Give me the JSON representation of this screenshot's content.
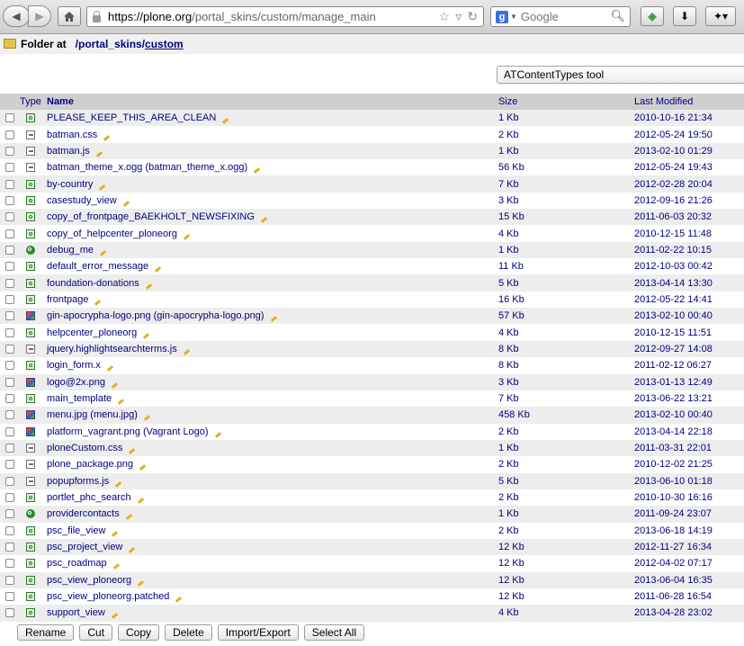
{
  "browser": {
    "url_host": "https://plone.org",
    "url_path": "/portal_skins/custom/manage_main",
    "search_placeholder": "Google"
  },
  "folder": {
    "label": "Folder at",
    "path_prefix": "/portal_skins/",
    "path_link": "custom"
  },
  "add_select": {
    "selected": "ATContentTypes tool"
  },
  "table": {
    "headers": {
      "type": "Type",
      "name": "Name",
      "size": "Size",
      "modified": "Last Modified"
    },
    "rows": [
      {
        "icon": "template-icon",
        "name": "PLEASE_KEEP_THIS_AREA_CLEAN",
        "size": "1 Kb",
        "date": "2010-10-16 21:34"
      },
      {
        "icon": "file-icon",
        "name": "batman.css",
        "size": "2 Kb",
        "date": "2012-05-24 19:50"
      },
      {
        "icon": "file-icon",
        "name": "batman.js",
        "size": "1 Kb",
        "date": "2013-02-10 01:29"
      },
      {
        "icon": "file-icon",
        "name": "batman_theme_x.ogg (batman_theme_x.ogg)",
        "size": "56 Kb",
        "date": "2012-05-24 19:43"
      },
      {
        "icon": "template-icon",
        "name": "by-country",
        "size": "7 Kb",
        "date": "2012-02-28 20:04"
      },
      {
        "icon": "template-icon",
        "name": "casestudy_view",
        "size": "3 Kb",
        "date": "2012-09-16 21:26"
      },
      {
        "icon": "template-icon",
        "name": "copy_of_frontpage_BAEKHOLT_NEWSFIXING",
        "size": "15 Kb",
        "date": "2011-06-03 20:32"
      },
      {
        "icon": "template-icon",
        "name": "copy_of_helpcenter_ploneorg",
        "size": "4 Kb",
        "date": "2010-12-15 11:48"
      },
      {
        "icon": "python-script-icon",
        "name": "debug_me",
        "size": "1 Kb",
        "date": "2011-02-22 10:15"
      },
      {
        "icon": "template-icon",
        "name": "default_error_message",
        "size": "11 Kb",
        "date": "2012-10-03 00:42"
      },
      {
        "icon": "template-icon",
        "name": "foundation-donations",
        "size": "5 Kb",
        "date": "2013-04-14 13:30"
      },
      {
        "icon": "template-icon",
        "name": "frontpage",
        "size": "16 Kb",
        "date": "2012-05-22 14:41"
      },
      {
        "icon": "image-icon",
        "name": "gin-apocrypha-logo.png (gin-apocrypha-logo.png)",
        "size": "57 Kb",
        "date": "2013-02-10 00:40"
      },
      {
        "icon": "template-icon",
        "name": "helpcenter_ploneorg",
        "size": "4 Kb",
        "date": "2010-12-15 11:51"
      },
      {
        "icon": "file-icon",
        "name": "jquery.highlightsearchterms.js",
        "size": "8 Kb",
        "date": "2012-09-27 14:08"
      },
      {
        "icon": "template-icon",
        "name": "login_form.x",
        "size": "8 Kb",
        "date": "2011-02-12 06:27"
      },
      {
        "icon": "image-icon",
        "name": "logo@2x.png",
        "size": "3 Kb",
        "date": "2013-01-13 12:49"
      },
      {
        "icon": "template-icon",
        "name": "main_template",
        "size": "7 Kb",
        "date": "2013-06-22 13:21"
      },
      {
        "icon": "image-icon",
        "name": "menu.jpg (menu.jpg)",
        "size": "458 Kb",
        "date": "2013-02-10 00:40"
      },
      {
        "icon": "image-icon",
        "name": "platform_vagrant.png (Vagrant Logo)",
        "size": "2 Kb",
        "date": "2013-04-14 22:18"
      },
      {
        "icon": "file-icon",
        "name": "ploneCustom.css",
        "size": "1 Kb",
        "date": "2011-03-31 22:01"
      },
      {
        "icon": "file-icon",
        "name": "plone_package.png",
        "size": "2 Kb",
        "date": "2010-12-02 21:25"
      },
      {
        "icon": "file-icon",
        "name": "popupforms.js",
        "size": "5 Kb",
        "date": "2013-06-10 01:18"
      },
      {
        "icon": "template-icon",
        "name": "portlet_phc_search",
        "size": "2 Kb",
        "date": "2010-10-30 16:16"
      },
      {
        "icon": "python-script-icon",
        "name": "providercontacts",
        "size": "1 Kb",
        "date": "2011-09-24 23:07"
      },
      {
        "icon": "template-icon",
        "name": "psc_file_view",
        "size": "2 Kb",
        "date": "2013-06-18 14:19"
      },
      {
        "icon": "template-icon",
        "name": "psc_project_view",
        "size": "12 Kb",
        "date": "2012-11-27 16:34"
      },
      {
        "icon": "template-icon",
        "name": "psc_roadmap",
        "size": "12 Kb",
        "date": "2012-04-02 07:17"
      },
      {
        "icon": "template-icon",
        "name": "psc_view_ploneorg",
        "size": "12 Kb",
        "date": "2013-06-04 16:35"
      },
      {
        "icon": "template-icon",
        "name": "psc_view_ploneorg.patched",
        "size": "12 Kb",
        "date": "2011-06-28 16:54"
      },
      {
        "icon": "template-icon",
        "name": "support_view",
        "size": "4 Kb",
        "date": "2013-04-28 23:02"
      }
    ]
  },
  "buttons": [
    "Rename",
    "Cut",
    "Copy",
    "Delete",
    "Import/Export",
    "Select All"
  ]
}
